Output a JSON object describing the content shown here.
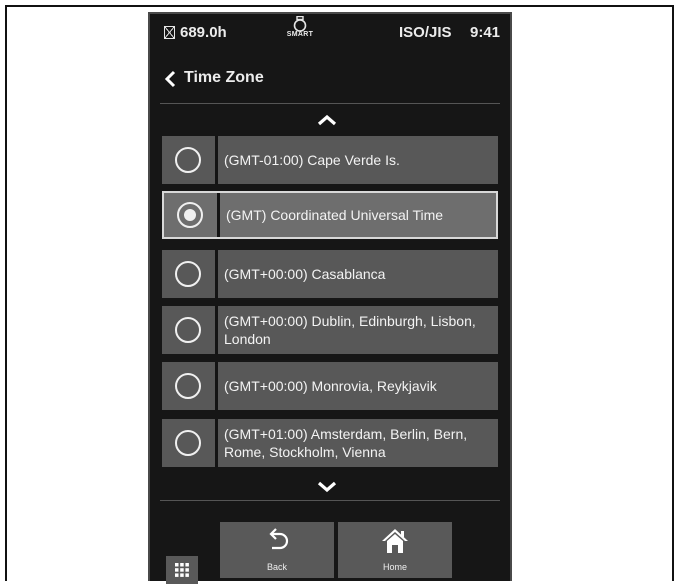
{
  "status_bar": {
    "hour_meter": "689.0h",
    "mode_label": "SMART",
    "standard": "ISO/JIS",
    "clock": "9:41"
  },
  "header": {
    "title": "Time Zone"
  },
  "options": [
    {
      "label": "(GMT-01:00) Cape Verde Is.",
      "selected": false
    },
    {
      "label": "(GMT) Coordinated Universal Time",
      "selected": true
    },
    {
      "label": "(GMT+00:00) Casablanca",
      "selected": false
    },
    {
      "label": "(GMT+00:00) Dublin, Edinburgh, Lisbon, London",
      "selected": false
    },
    {
      "label": "(GMT+00:00) Monrovia, Reykjavik",
      "selected": false
    },
    {
      "label": "(GMT+01:00) Amsterdam, Berlin, Bern, Rome, Stockholm, Vienna",
      "selected": false
    }
  ],
  "bottom_bar": {
    "back_label": "Back",
    "home_label": "Home"
  },
  "colors": {
    "screen_bg": "#161616",
    "option_bg": "#585858",
    "selected_bg": "#6e6e6e"
  }
}
